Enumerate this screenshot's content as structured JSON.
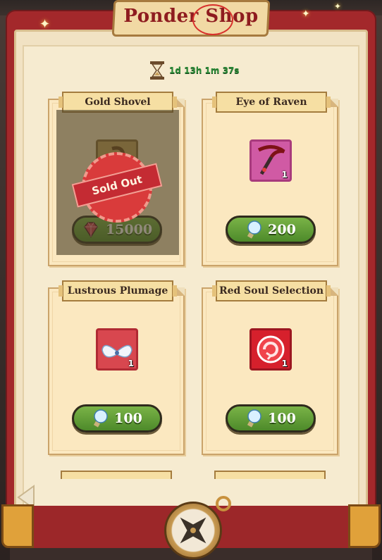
{
  "shop": {
    "title": "Ponder Shop",
    "timer": "1d 13h 1m 37s"
  },
  "items": [
    {
      "name": "Gold Shovel",
      "price": "15000",
      "currency_icon": "gem-icon",
      "quantity": "",
      "sold_out": true,
      "sold_out_label": "Sold Out"
    },
    {
      "name": "Eye of Raven",
      "price": "200",
      "currency_icon": "bulb-icon",
      "quantity": "1",
      "sold_out": false
    },
    {
      "name": "Lustrous Plumage",
      "price": "100",
      "currency_icon": "bulb-icon",
      "quantity": "1",
      "sold_out": false
    },
    {
      "name": "Red Soul Selection",
      "price": "100",
      "currency_icon": "bulb-icon",
      "quantity": "1",
      "sold_out": false
    }
  ],
  "colors": {
    "frame": "#a3282b",
    "title_text": "#8e1c1f",
    "timer_text": "#2b8a37",
    "price_button": "#5e9a33",
    "sold_out": "#c42b33"
  }
}
